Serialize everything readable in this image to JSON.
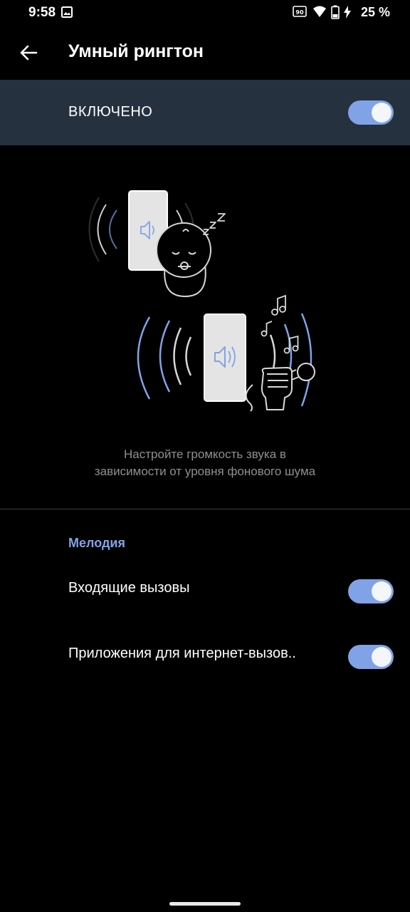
{
  "status_bar": {
    "time": "9:58",
    "battery_percent": "25 %",
    "icons": [
      "gallery-icon",
      "data-saver-icon",
      "wifi-icon",
      "battery-charging-icon"
    ]
  },
  "header": {
    "title": "Умный рингтон",
    "back_icon": "arrow-back-icon"
  },
  "master_switch": {
    "label": "ВКЛЮЧЕНО",
    "on": true
  },
  "illustration": {
    "icons": [
      "phone-speaker-icon",
      "sleeping-baby-icon",
      "zzz-icon",
      "music-notes-icon",
      "microphone-hand-icon"
    ]
  },
  "description": {
    "line1": "Настройте громкость звука в",
    "line2": "зависимости от уровня фонового шума"
  },
  "section": {
    "header": "Мелодия",
    "items": [
      {
        "label": "Входящие вызовы",
        "on": true
      },
      {
        "label": "Приложения для интернет-вызов..",
        "on": true
      }
    ]
  },
  "colors": {
    "accent": "#7fa3e6",
    "master_row_bg": "#263140",
    "background": "#000000",
    "description_text": "#8f8f8f"
  }
}
